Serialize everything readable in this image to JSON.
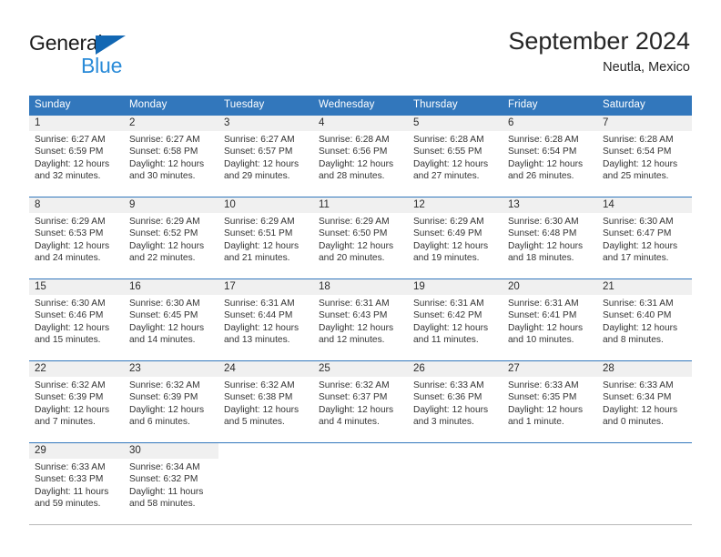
{
  "brand": {
    "name_part1": "General",
    "name_part2": "Blue",
    "triangle_color": "#1267b3",
    "blue_color": "#2a8bd8"
  },
  "header": {
    "title": "September 2024",
    "subtitle": "Neutla, Mexico"
  },
  "colors": {
    "header_band": "#3277bc",
    "daynum_band": "#f0f0f0",
    "row_border": "#3277bc",
    "text": "#333333"
  },
  "weekday_headers": [
    "Sunday",
    "Monday",
    "Tuesday",
    "Wednesday",
    "Thursday",
    "Friday",
    "Saturday"
  ],
  "weeks": [
    [
      {
        "day": "1",
        "sunrise": "Sunrise: 6:27 AM",
        "sunset": "Sunset: 6:59 PM",
        "daylight": "Daylight: 12 hours and 32 minutes."
      },
      {
        "day": "2",
        "sunrise": "Sunrise: 6:27 AM",
        "sunset": "Sunset: 6:58 PM",
        "daylight": "Daylight: 12 hours and 30 minutes."
      },
      {
        "day": "3",
        "sunrise": "Sunrise: 6:27 AM",
        "sunset": "Sunset: 6:57 PM",
        "daylight": "Daylight: 12 hours and 29 minutes."
      },
      {
        "day": "4",
        "sunrise": "Sunrise: 6:28 AM",
        "sunset": "Sunset: 6:56 PM",
        "daylight": "Daylight: 12 hours and 28 minutes."
      },
      {
        "day": "5",
        "sunrise": "Sunrise: 6:28 AM",
        "sunset": "Sunset: 6:55 PM",
        "daylight": "Daylight: 12 hours and 27 minutes."
      },
      {
        "day": "6",
        "sunrise": "Sunrise: 6:28 AM",
        "sunset": "Sunset: 6:54 PM",
        "daylight": "Daylight: 12 hours and 26 minutes."
      },
      {
        "day": "7",
        "sunrise": "Sunrise: 6:28 AM",
        "sunset": "Sunset: 6:54 PM",
        "daylight": "Daylight: 12 hours and 25 minutes."
      }
    ],
    [
      {
        "day": "8",
        "sunrise": "Sunrise: 6:29 AM",
        "sunset": "Sunset: 6:53 PM",
        "daylight": "Daylight: 12 hours and 24 minutes."
      },
      {
        "day": "9",
        "sunrise": "Sunrise: 6:29 AM",
        "sunset": "Sunset: 6:52 PM",
        "daylight": "Daylight: 12 hours and 22 minutes."
      },
      {
        "day": "10",
        "sunrise": "Sunrise: 6:29 AM",
        "sunset": "Sunset: 6:51 PM",
        "daylight": "Daylight: 12 hours and 21 minutes."
      },
      {
        "day": "11",
        "sunrise": "Sunrise: 6:29 AM",
        "sunset": "Sunset: 6:50 PM",
        "daylight": "Daylight: 12 hours and 20 minutes."
      },
      {
        "day": "12",
        "sunrise": "Sunrise: 6:29 AM",
        "sunset": "Sunset: 6:49 PM",
        "daylight": "Daylight: 12 hours and 19 minutes."
      },
      {
        "day": "13",
        "sunrise": "Sunrise: 6:30 AM",
        "sunset": "Sunset: 6:48 PM",
        "daylight": "Daylight: 12 hours and 18 minutes."
      },
      {
        "day": "14",
        "sunrise": "Sunrise: 6:30 AM",
        "sunset": "Sunset: 6:47 PM",
        "daylight": "Daylight: 12 hours and 17 minutes."
      }
    ],
    [
      {
        "day": "15",
        "sunrise": "Sunrise: 6:30 AM",
        "sunset": "Sunset: 6:46 PM",
        "daylight": "Daylight: 12 hours and 15 minutes."
      },
      {
        "day": "16",
        "sunrise": "Sunrise: 6:30 AM",
        "sunset": "Sunset: 6:45 PM",
        "daylight": "Daylight: 12 hours and 14 minutes."
      },
      {
        "day": "17",
        "sunrise": "Sunrise: 6:31 AM",
        "sunset": "Sunset: 6:44 PM",
        "daylight": "Daylight: 12 hours and 13 minutes."
      },
      {
        "day": "18",
        "sunrise": "Sunrise: 6:31 AM",
        "sunset": "Sunset: 6:43 PM",
        "daylight": "Daylight: 12 hours and 12 minutes."
      },
      {
        "day": "19",
        "sunrise": "Sunrise: 6:31 AM",
        "sunset": "Sunset: 6:42 PM",
        "daylight": "Daylight: 12 hours and 11 minutes."
      },
      {
        "day": "20",
        "sunrise": "Sunrise: 6:31 AM",
        "sunset": "Sunset: 6:41 PM",
        "daylight": "Daylight: 12 hours and 10 minutes."
      },
      {
        "day": "21",
        "sunrise": "Sunrise: 6:31 AM",
        "sunset": "Sunset: 6:40 PM",
        "daylight": "Daylight: 12 hours and 8 minutes."
      }
    ],
    [
      {
        "day": "22",
        "sunrise": "Sunrise: 6:32 AM",
        "sunset": "Sunset: 6:39 PM",
        "daylight": "Daylight: 12 hours and 7 minutes."
      },
      {
        "day": "23",
        "sunrise": "Sunrise: 6:32 AM",
        "sunset": "Sunset: 6:39 PM",
        "daylight": "Daylight: 12 hours and 6 minutes."
      },
      {
        "day": "24",
        "sunrise": "Sunrise: 6:32 AM",
        "sunset": "Sunset: 6:38 PM",
        "daylight": "Daylight: 12 hours and 5 minutes."
      },
      {
        "day": "25",
        "sunrise": "Sunrise: 6:32 AM",
        "sunset": "Sunset: 6:37 PM",
        "daylight": "Daylight: 12 hours and 4 minutes."
      },
      {
        "day": "26",
        "sunrise": "Sunrise: 6:33 AM",
        "sunset": "Sunset: 6:36 PM",
        "daylight": "Daylight: 12 hours and 3 minutes."
      },
      {
        "day": "27",
        "sunrise": "Sunrise: 6:33 AM",
        "sunset": "Sunset: 6:35 PM",
        "daylight": "Daylight: 12 hours and 1 minute."
      },
      {
        "day": "28",
        "sunrise": "Sunrise: 6:33 AM",
        "sunset": "Sunset: 6:34 PM",
        "daylight": "Daylight: 12 hours and 0 minutes."
      }
    ],
    [
      {
        "day": "29",
        "sunrise": "Sunrise: 6:33 AM",
        "sunset": "Sunset: 6:33 PM",
        "daylight": "Daylight: 11 hours and 59 minutes."
      },
      {
        "day": "30",
        "sunrise": "Sunrise: 6:34 AM",
        "sunset": "Sunset: 6:32 PM",
        "daylight": "Daylight: 11 hours and 58 minutes."
      },
      {
        "day": "",
        "sunrise": "",
        "sunset": "",
        "daylight": ""
      },
      {
        "day": "",
        "sunrise": "",
        "sunset": "",
        "daylight": ""
      },
      {
        "day": "",
        "sunrise": "",
        "sunset": "",
        "daylight": ""
      },
      {
        "day": "",
        "sunrise": "",
        "sunset": "",
        "daylight": ""
      },
      {
        "day": "",
        "sunrise": "",
        "sunset": "",
        "daylight": ""
      }
    ]
  ]
}
